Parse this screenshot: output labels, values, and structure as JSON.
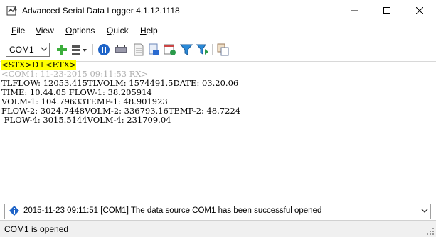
{
  "window": {
    "title": "Advanced Serial Data Logger 4.1.12.1118"
  },
  "menu": {
    "items": [
      {
        "label": "File",
        "u": "F",
        "rest": "ile"
      },
      {
        "label": "View",
        "u": "V",
        "rest": "iew"
      },
      {
        "label": "Options",
        "u": "O",
        "rest": "ptions"
      },
      {
        "label": "Quick",
        "u": "Q",
        "rest": "uick"
      },
      {
        "label": "Help",
        "u": "H",
        "rest": "elp"
      }
    ]
  },
  "toolbar": {
    "port_value": "COM1",
    "icons": [
      "add-icon",
      "list-options-icon",
      "pause-icon",
      "plugin-icon",
      "document-icon",
      "data-export-icon",
      "schedule-icon",
      "filter-icon",
      "filter-next-icon",
      "copy-icon"
    ]
  },
  "output": {
    "packet": "<STX>D+<ETX>",
    "rx_header": "<COM1: 11-23-2015 09:11:53 RX>",
    "lines": [
      "TLFLOW: 12053.415TLVOLM: 1574491.5DATE: 03.20.06",
      "TIME: 10.44.05 FLOW-1: 38.205914",
      "VOLM-1: 104.79633TEMP-1: 48.901923",
      "FLOW-2: 3024.7448VOLM-2: 336793.16TEMP-2: 48.7224",
      " FLOW-4: 3015.5144VOLM-4: 231709.04"
    ]
  },
  "message": {
    "text": "2015-11-23 09:11:51 [COM1] The data source COM1 has been successful opened"
  },
  "status": {
    "text": "COM1 is opened"
  },
  "colors": {
    "highlight": "#ffff00",
    "rx_header": "#b0b0b0",
    "accent": "#0a64c8"
  }
}
